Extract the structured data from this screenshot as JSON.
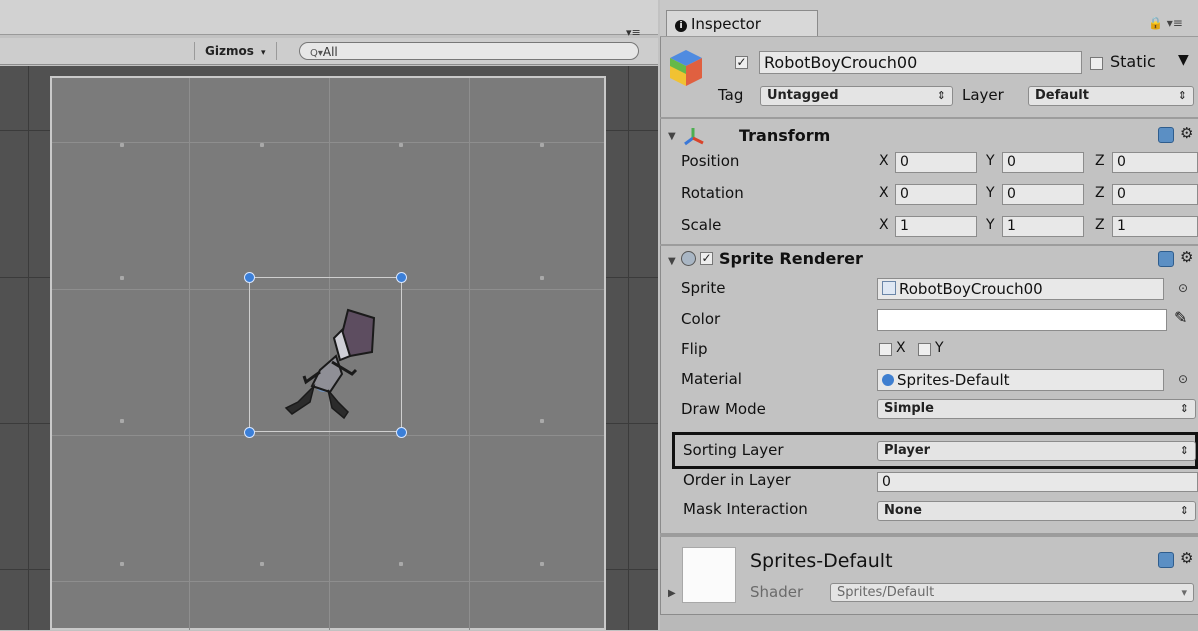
{
  "scene": {
    "menu_glyph": "▾≡",
    "toolbar": {
      "gizmos_label": "Gizmos",
      "gizmos_arrow": "▾",
      "search_placeholder": "All",
      "search_icon": "Q▾"
    }
  },
  "inspector": {
    "tab_label": "Inspector",
    "tab_icon": "info-icon",
    "lock_menu": "🔒 ▾≡",
    "object": {
      "name": "RobotBoyCrouch00",
      "active_checked": true,
      "static_label": "Static",
      "static_checked": false,
      "tag_label": "Tag",
      "tag_value": "Untagged",
      "layer_label": "Layer",
      "layer_value": "Default"
    },
    "transform": {
      "title": "Transform",
      "rows": [
        {
          "label": "Position",
          "x": "0",
          "y": "0",
          "z": "0"
        },
        {
          "label": "Rotation",
          "x": "0",
          "y": "0",
          "z": "0"
        },
        {
          "label": "Scale",
          "x": "1",
          "y": "1",
          "z": "1"
        }
      ],
      "axis_x": "X",
      "axis_y": "Y",
      "axis_z": "Z"
    },
    "sprite_renderer": {
      "title": "Sprite Renderer",
      "enabled": true,
      "sprite_label": "Sprite",
      "sprite_value": "RobotBoyCrouch00",
      "color_label": "Color",
      "color_value": "#ffffff",
      "flip_label": "Flip",
      "flip_x": "X",
      "flip_y": "Y",
      "material_label": "Material",
      "material_value": "Sprites-Default",
      "draw_mode_label": "Draw Mode",
      "draw_mode_value": "Simple",
      "sorting_layer_label": "Sorting Layer",
      "sorting_layer_value": "Player",
      "order_label": "Order in Layer",
      "order_value": "0",
      "mask_label": "Mask Interaction",
      "mask_value": "None"
    },
    "material": {
      "name": "Sprites-Default",
      "shader_label": "Shader",
      "shader_value": "Sprites/Default"
    }
  },
  "colors": {
    "scene_bg": "#515151",
    "canvas_bg": "#7b7b7b",
    "handle": "#3b7fd8",
    "highlight_border": "#111111"
  }
}
